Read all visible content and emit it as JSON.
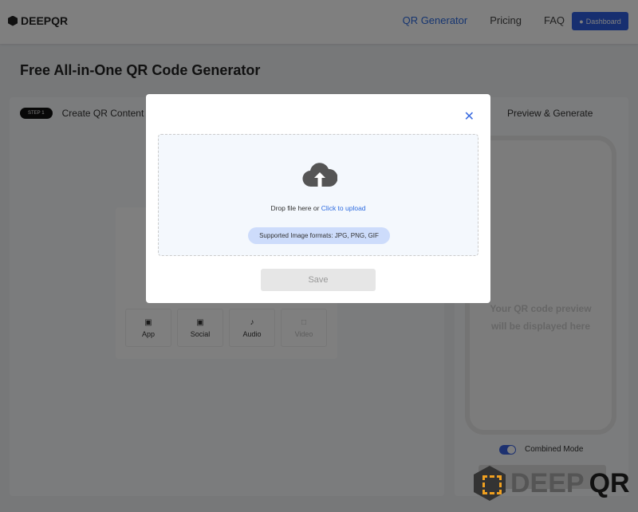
{
  "nav": {
    "logo": "DEEPQR",
    "links": [
      "QR Generator",
      "Pricing",
      "FAQ"
    ],
    "dashboard": "Dashboard"
  },
  "page": {
    "title": "Free All-in-One QR Code Generator"
  },
  "step1": {
    "badge": "STEP 1",
    "label": "Create QR Content"
  },
  "step2": {
    "label": "Preview & Generate"
  },
  "tiles": [
    {
      "label": "App",
      "icon": "app-icon"
    },
    {
      "label": "Social",
      "icon": "social-icon"
    },
    {
      "label": "Audio",
      "icon": "audio-icon"
    },
    {
      "label": "Video",
      "icon": "video-icon"
    }
  ],
  "preview": {
    "line1": "Your QR code preview",
    "line2": "will be displayed here",
    "combined_mode": "Combined Mode"
  },
  "modal": {
    "drop_text": "Drop file here or",
    "upload_link": "Click to upload",
    "formats": "Supported Image formats: JPG, PNG, GIF",
    "save": "Save"
  },
  "watermark": "DEEPQR",
  "colors": {
    "accent": "#2d6be0",
    "overlay": "rgba(0,0,0,0.5)"
  }
}
